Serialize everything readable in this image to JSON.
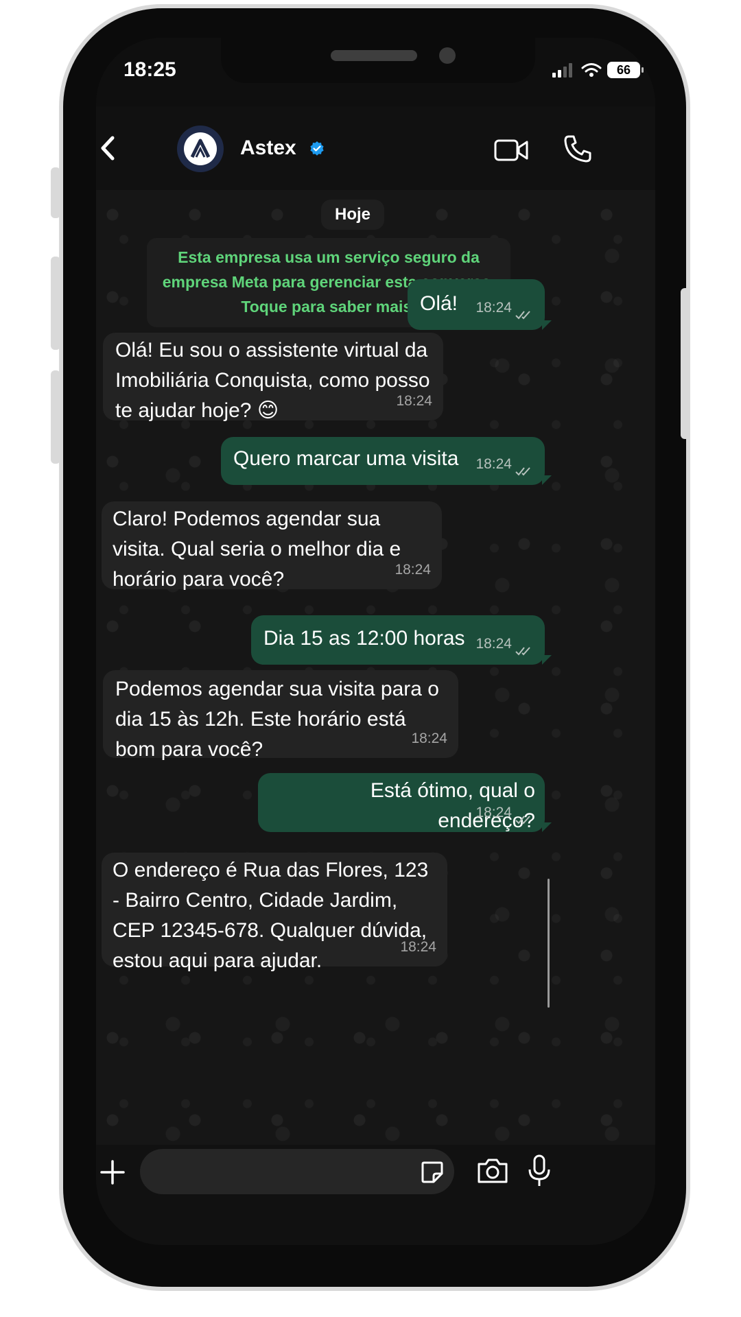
{
  "status_bar": {
    "time": "18:25",
    "battery": "66"
  },
  "header": {
    "contact_name": "Astex",
    "verified": true
  },
  "chat": {
    "date_chip": "Hoje",
    "notice": "Esta empresa usa um serviço seguro da empresa Meta para gerenciar esta conversa. Toque para saber mais.",
    "messages": [
      {
        "direction": "out",
        "text": "Olá!",
        "time": "18:24"
      },
      {
        "direction": "in",
        "text": "Olá! Eu sou o assistente virtual da Imobiliária Conquista, como posso te ajudar hoje? 😊",
        "time": "18:24"
      },
      {
        "direction": "out",
        "text": "Quero marcar uma visita",
        "time": "18:24"
      },
      {
        "direction": "in",
        "text": "Claro! Podemos agendar sua visita. Qual seria o melhor dia e horário para você?",
        "time": "18:24"
      },
      {
        "direction": "out",
        "text": "Dia 15 as 12:00 horas",
        "time": "18:24"
      },
      {
        "direction": "in",
        "text": "Podemos agendar sua visita para o dia 15 às 12h. Este horário está bom para você?",
        "time": "18:24"
      },
      {
        "direction": "out",
        "text": "Está ótimo, qual o endereço?",
        "time": "18:24"
      },
      {
        "direction": "in",
        "text": "O endereço é Rua das Flores, 123 - Bairro Centro, Cidade Jardim, CEP 12345-678. Qualquer dúvida, estou aqui para ajudar.",
        "time": "18:24"
      }
    ]
  },
  "input": {
    "placeholder": ""
  },
  "colors": {
    "outgoing_bubble": "#1b4d3a",
    "incoming_bubble": "#232323",
    "notice_text": "#5fd47a",
    "verified_badge": "#1d9bf0"
  }
}
